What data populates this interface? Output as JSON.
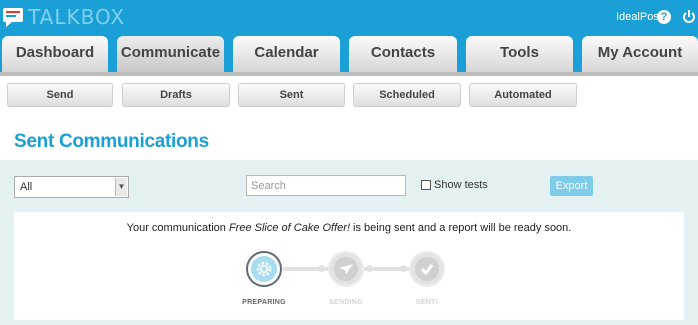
{
  "app": {
    "brand": "TALKBOX",
    "user": "IdealPos"
  },
  "main_nav": [
    {
      "label": "Dashboard"
    },
    {
      "label": "Communicate"
    },
    {
      "label": "Calendar"
    },
    {
      "label": "Contacts"
    },
    {
      "label": "Tools"
    },
    {
      "label": "My Account"
    }
  ],
  "sub_nav": [
    {
      "label": "Send"
    },
    {
      "label": "Drafts"
    },
    {
      "label": "Sent"
    },
    {
      "label": "Scheduled"
    },
    {
      "label": "Automated"
    }
  ],
  "page": {
    "title": "Sent Communications"
  },
  "filters": {
    "select_value": "All",
    "search_placeholder": "Search",
    "show_tests_label": "Show tests",
    "show_tests_checked": false,
    "export_label": "Export"
  },
  "message": {
    "prefix": "Your communication ",
    "name": "Free Slice of Cake Offer!",
    "suffix": " is being sent and a report will be ready soon."
  },
  "progress": {
    "steps": [
      {
        "label": "PREPARING",
        "icon": "gear-icon",
        "state": "active"
      },
      {
        "label": "SENDING",
        "icon": "paper-plane-icon",
        "state": "pending"
      },
      {
        "label": "SENT!",
        "icon": "checkmark-icon",
        "state": "pending"
      }
    ]
  },
  "colors": {
    "brand": "#1aa0d6",
    "export": "#7fcbea",
    "band": "#e4f1f2"
  }
}
